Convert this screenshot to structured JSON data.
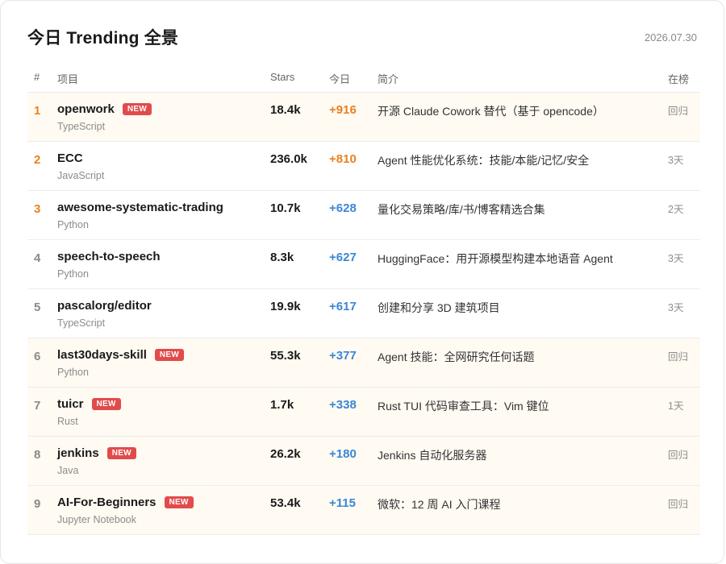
{
  "header": {
    "title": "今日 Trending 全景",
    "date": "2026.07.30"
  },
  "columns": {
    "rank": "#",
    "project": "项目",
    "stars": "Stars",
    "today": "今日",
    "desc": "简介",
    "onboard": "在榜"
  },
  "rows": [
    {
      "rank": "1",
      "name": "openwork",
      "badge": "NEW",
      "lang": "TypeScript",
      "stars": "18.4k",
      "today": "+916",
      "desc": "开源 Claude Cowork 替代（基于 opencode）",
      "onboard": "回归"
    },
    {
      "rank": "2",
      "name": "ECC",
      "badge": "",
      "lang": "JavaScript",
      "stars": "236.0k",
      "today": "+810",
      "desc": "Agent 性能优化系统：技能/本能/记忆/安全",
      "onboard": "3天"
    },
    {
      "rank": "3",
      "name": "awesome-systematic-trading",
      "badge": "",
      "lang": "Python",
      "stars": "10.7k",
      "today": "+628",
      "desc": "量化交易策略/库/书/博客精选合集",
      "onboard": "2天"
    },
    {
      "rank": "4",
      "name": "speech-to-speech",
      "badge": "",
      "lang": "Python",
      "stars": "8.3k",
      "today": "+627",
      "desc": "HuggingFace：用开源模型构建本地语音 Agent",
      "onboard": "3天"
    },
    {
      "rank": "5",
      "name": "pascalorg/editor",
      "badge": "",
      "lang": "TypeScript",
      "stars": "19.9k",
      "today": "+617",
      "desc": "创建和分享 3D 建筑项目",
      "onboard": "3天"
    },
    {
      "rank": "6",
      "name": "last30days-skill",
      "badge": "NEW",
      "lang": "Python",
      "stars": "55.3k",
      "today": "+377",
      "desc": "Agent 技能：全网研究任何话题",
      "onboard": "回归"
    },
    {
      "rank": "7",
      "name": "tuicr",
      "badge": "NEW",
      "lang": "Rust",
      "stars": "1.7k",
      "today": "+338",
      "desc": "Rust TUI 代码审查工具：Vim 键位",
      "onboard": "1天"
    },
    {
      "rank": "8",
      "name": "jenkins",
      "badge": "NEW",
      "lang": "Java",
      "stars": "26.2k",
      "today": "+180",
      "desc": "Jenkins 自动化服务器",
      "onboard": "回归"
    },
    {
      "rank": "9",
      "name": "AI-For-Beginners",
      "badge": "NEW",
      "lang": "Jupyter Notebook",
      "stars": "53.4k",
      "today": "+115",
      "desc": "微软：12 周 AI 入门课程",
      "onboard": "回归"
    }
  ],
  "colors": {
    "rank_top": "#e8821e",
    "today_orange": "#e8821e",
    "today_blue": "#3a86d4",
    "badge_bg": "#e14b4b",
    "highlight_row_bg": "#fffaf2"
  }
}
